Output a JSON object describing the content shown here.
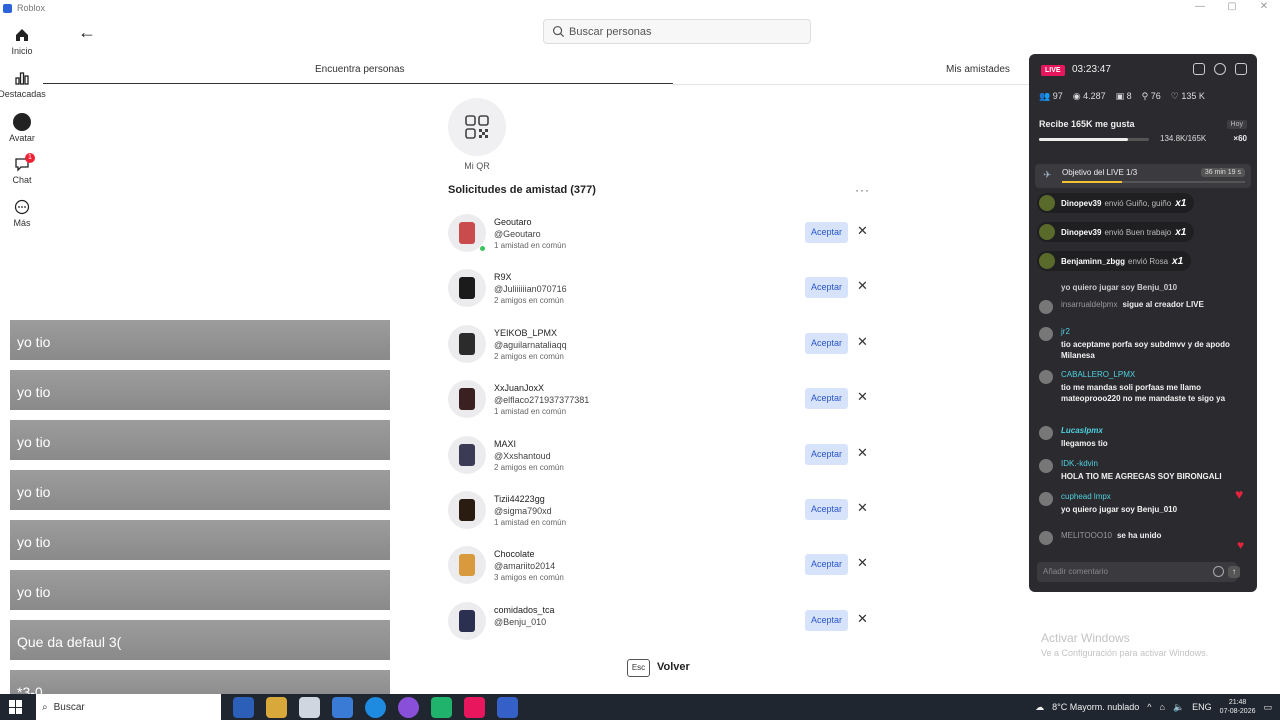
{
  "window": {
    "title": "Roblox"
  },
  "nav": [
    {
      "label": "Inicio",
      "icon": "home-icon"
    },
    {
      "label": "Destacadas",
      "icon": "chart-icon"
    },
    {
      "label": "Avatar",
      "icon": "avatar-icon"
    },
    {
      "label": "Chat",
      "icon": "chat-icon",
      "badge": "1"
    },
    {
      "label": "Más",
      "icon": "more-icon"
    }
  ],
  "search": {
    "placeholder": "Buscar personas"
  },
  "tabs": {
    "find": "Encuentra personas",
    "mine": "Mis amistades"
  },
  "qr": {
    "label": "Mi QR"
  },
  "requests": {
    "title": "Solicitudes de amistad (377)",
    "accept_label": "Aceptar",
    "items": [
      {
        "name": "Geoutaro",
        "handle": "@Geoutaro",
        "mutual": "1 amistad en común",
        "online": true,
        "color": "#c94b4b"
      },
      {
        "name": "R9X",
        "handle": "@Juliiiiiian070716",
        "mutual": "2 amigos en común",
        "online": false,
        "color": "#1b1b1b"
      },
      {
        "name": "YEIKOB_LPMX",
        "handle": "@aguilarnataliaqq",
        "mutual": "2 amigos en común",
        "online": false,
        "color": "#2b2b2b"
      },
      {
        "name": "XxJuanJoxX",
        "handle": "@elflaco271937377381",
        "mutual": "1 amistad en común",
        "online": false,
        "color": "#3a2020"
      },
      {
        "name": "MAXI",
        "handle": "@Xxshantoud",
        "mutual": "2 amigos en común",
        "online": false,
        "color": "#3b3b55"
      },
      {
        "name": "Tizii44223gg",
        "handle": "@sigma790xd",
        "mutual": "1 amistad en común",
        "online": false,
        "color": "#2a1c10"
      },
      {
        "name": "Chocolate",
        "handle": "@amariito2014",
        "mutual": "3 amigos en común",
        "online": false,
        "color": "#d89a3c"
      },
      {
        "name": "comidados_tca",
        "handle": "@Benju_010",
        "mutual": "",
        "online": false,
        "color": "#2c3050"
      }
    ]
  },
  "footer": {
    "esc": "Esc",
    "back": "Volver"
  },
  "overlay_chat": [
    {
      "msg": "yo tio"
    },
    {
      "msg": "yo tio"
    },
    {
      "msg": "yo tio"
    },
    {
      "msg": "yo tio"
    },
    {
      "msg": "yo tio"
    },
    {
      "msg": "yo tio"
    },
    {
      "msg": "Que da defaul 3("
    },
    {
      "msg": "*3-0"
    }
  ],
  "live": {
    "badge": "LIVE",
    "time": "03:23:47",
    "stats": {
      "viewers": "97",
      "views": "4.287",
      "gifts": "8",
      "shares": "76",
      "likes": "135 K"
    },
    "goal_title": "Recibe 165K me gusta",
    "goal_tag": "Hoy",
    "goal_progress": 0.8127,
    "goal_text": "134.8K/165K",
    "goal_multiplier": "×60",
    "objective_title": "Objetivo del LIVE 1/3",
    "objective_timer": "36 min 19 s",
    "objective_progress": 0.33,
    "gifts": [
      {
        "user": "Dinopev39",
        "text": "envió Guiño, guiño",
        "count": "x1"
      },
      {
        "user": "Dinopev39",
        "text": "envió Buen trabajo",
        "count": "x1"
      },
      {
        "user": "Benjaminn_zbgg",
        "text": "envió Rosa",
        "count": "x1"
      }
    ],
    "comments": [
      {
        "user": "",
        "text": "yo quiero jugar soy Benju_010"
      },
      {
        "user": "insarrualdelpmx",
        "text": "sigue al creador LIVE"
      },
      {
        "user": "jr2",
        "text": "tio aceptame porfa soy subdmvv y de apodo Milanesa"
      },
      {
        "user": "CABALLERO_LPMX",
        "text": "tio me mandas soli porfaas me llamo mateoprooo220 no me mandaste te sigo ya"
      },
      {
        "user": "Lucaslpmx",
        "text": "llegamos tio"
      },
      {
        "user": "IDK.-kdvin",
        "text": "HOLA TIO ME AGREGAS SOY BIRONGALI"
      },
      {
        "user": "cuphead lmpx",
        "text": "yo quiero jugar soy Benju_010"
      },
      {
        "user": "MELITOOO10",
        "text": "se ha unido"
      }
    ],
    "comment_placeholder": "Añadir comentario"
  },
  "watermark": {
    "title": "Activar Windows",
    "subtitle": "Ve a Configuración para activar Windows."
  },
  "taskbar": {
    "search": "Buscar",
    "weather": "8°C  Mayorm. nublado",
    "lang": "ENG",
    "time": "21:48",
    "date": "07-08-2026"
  }
}
